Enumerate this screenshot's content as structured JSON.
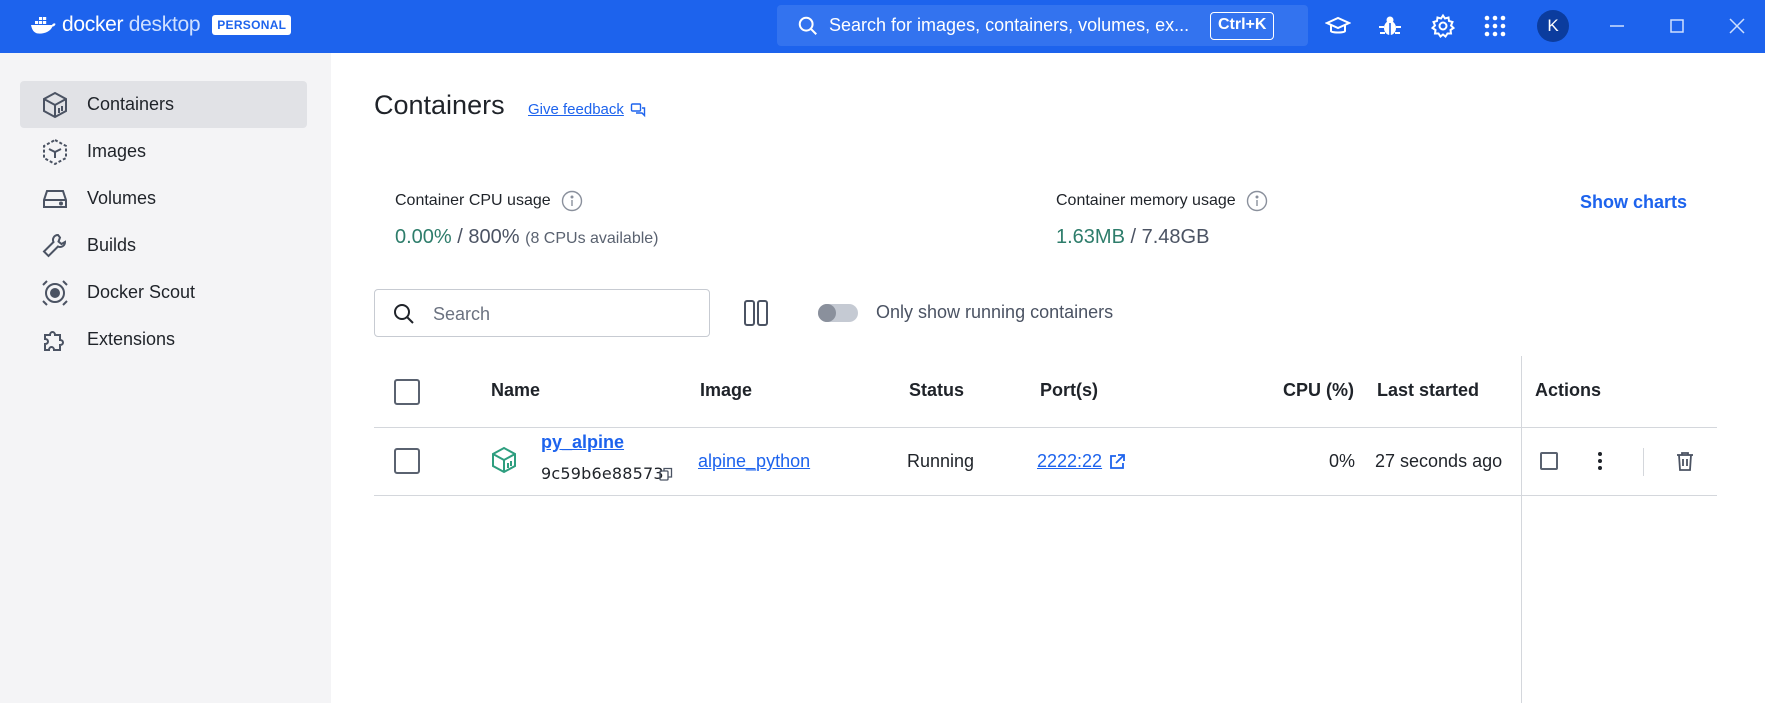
{
  "topbar": {
    "brand_primary": "docker",
    "brand_secondary": "desktop",
    "plan_badge": "PERSONAL",
    "search_placeholder": "Search for images, containers, volumes, ex...",
    "search_shortcut": "Ctrl+K",
    "avatar_initial": "K",
    "icons": [
      "learning-center-icon",
      "troubleshoot-bug-icon",
      "settings-gear-icon",
      "apps-grid-icon"
    ],
    "accent_color": "#1d63ed"
  },
  "sidebar": {
    "items": [
      {
        "label": "Containers",
        "icon": "container-cube-icon",
        "active": true
      },
      {
        "label": "Images",
        "icon": "image-layers-icon",
        "active": false
      },
      {
        "label": "Volumes",
        "icon": "volume-disk-icon",
        "active": false
      },
      {
        "label": "Builds",
        "icon": "wrench-icon",
        "active": false
      },
      {
        "label": "Docker Scout",
        "icon": "scout-icon",
        "active": false
      },
      {
        "label": "Extensions",
        "icon": "puzzle-icon",
        "active": false
      }
    ]
  },
  "main": {
    "title": "Containers",
    "feedback_link": "Give feedback",
    "cpu": {
      "label": "Container CPU usage",
      "used": "0.00%",
      "sep": " / ",
      "total": "800%",
      "note": "(8 CPUs available)"
    },
    "memory": {
      "label": "Container memory usage",
      "used": "1.63MB",
      "sep": " / ",
      "total": "7.48GB"
    },
    "show_charts": "Show charts",
    "search_placeholder": "Search",
    "toggle_label": "Only show running containers",
    "toggle_on": false
  },
  "table": {
    "columns": [
      "Name",
      "Image",
      "Status",
      "Port(s)",
      "CPU (%)",
      "Last started",
      "Actions"
    ],
    "rows": [
      {
        "name": "py_alpine",
        "id": "9c59b6e88573",
        "image": "alpine_python",
        "status": "Running",
        "ports": "2222:22",
        "cpu": "0%",
        "last_started": "27 seconds ago",
        "status_color": "#2e9e7f"
      }
    ]
  }
}
